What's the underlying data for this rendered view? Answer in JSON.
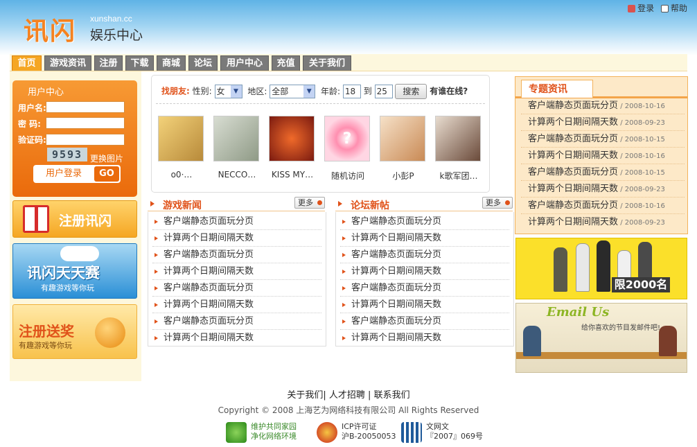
{
  "header": {
    "logo_cn": "讯闪",
    "logo_en": "xunshan.cc",
    "logo_sub": "娱乐中心",
    "login_link": "登录",
    "help_link": "帮助"
  },
  "nav": {
    "tabs": [
      {
        "label": "首页",
        "active": true
      },
      {
        "label": "游戏资讯"
      },
      {
        "label": "注册"
      },
      {
        "label": "下载"
      },
      {
        "label": "商城"
      },
      {
        "label": "论坛"
      },
      {
        "label": "用户中心"
      },
      {
        "label": "充值"
      },
      {
        "label": "关于我们"
      }
    ]
  },
  "login": {
    "title": "用户中心",
    "username_label": "用户名:",
    "password_label": "密  码:",
    "captcha_label": "验证码:",
    "captcha_text": "9593",
    "change_image": "更换图片",
    "login_button": "用户登录",
    "go_button": "GO"
  },
  "banners": {
    "register": "注册讯闪",
    "daily_title": "讯闪天天赛",
    "daily_sub": "有趣游戏等你玩",
    "prize_title": "注册送奖",
    "prize_sub": "有趣游戏等你玩"
  },
  "finder": {
    "title": "找朋友:",
    "gender_label": "性别:",
    "gender_value": "女",
    "region_label": "地区:",
    "region_value": "全部",
    "age_label": "年龄:",
    "age_from": "18",
    "age_to_label": "到",
    "age_to": "25",
    "search_button": "搜索",
    "online_label": "有谁在线?",
    "people": [
      {
        "name": "o0·…"
      },
      {
        "name": "NECCO…"
      },
      {
        "name": "KISS MY…"
      },
      {
        "name": "随机访问"
      },
      {
        "name": "小彭P"
      },
      {
        "name": "k歌军团…"
      }
    ]
  },
  "game_news": {
    "title": "游戏新闻",
    "more": "更多",
    "items": [
      "客户端静态页面玩分页",
      "计算两个日期间隔天数",
      "客户端静态页面玩分页",
      "计算两个日期间隔天数",
      "客户端静态页面玩分页",
      "计算两个日期间隔天数",
      "客户端静态页面玩分页",
      "计算两个日期间隔天数"
    ]
  },
  "forum": {
    "title": "论坛新帖",
    "more": "更多",
    "items": [
      "客户端静态页面玩分页",
      "计算两个日期间隔天数",
      "客户端静态页面玩分页",
      "计算两个日期间隔天数",
      "客户端静态页面玩分页",
      "计算两个日期间隔天数",
      "客户端静态页面玩分页",
      "计算两个日期间隔天数"
    ]
  },
  "special": {
    "title": "专题资讯",
    "items": [
      {
        "text": "客户端静态页面玩分页",
        "date": " / 2008-10-16"
      },
      {
        "text": "计算两个日期间隔天数",
        "date": " / 2008-09-23"
      },
      {
        "text": "客户端静态页面玩分页",
        "date": " / 2008-10-15"
      },
      {
        "text": "计算两个日期间隔天数",
        "date": " / 2008-10-16"
      },
      {
        "text": "客户端静态页面玩分页",
        "date": " / 2008-10-15"
      },
      {
        "text": "计算两个日期间隔天数",
        "date": " / 2008-09-23"
      },
      {
        "text": "客户端静态页面玩分页",
        "date": " / 2008-10-16"
      },
      {
        "text": "计算两个日期间隔天数",
        "date": " / 2008-09-23"
      }
    ]
  },
  "ads": {
    "limit": "限2000名",
    "email_title": "Email Us",
    "email_sub": "给你喜欢的节目发邮件吧!"
  },
  "footer": {
    "links": "关于我们| 人才招聘 | 联系我们",
    "copyright": "Copyright © 2008 上海艺为网络科技有限公司 All Rights Reserved",
    "badge1_a": "维护共同家园",
    "badge1_b": "净化网络环境",
    "badge2_a": "ICP许可证",
    "badge2_b": "沪B-20050053",
    "badge3_a": "文网文",
    "badge3_b": "『2007』069号"
  },
  "colors": {
    "accent": "#f58220",
    "nav_active": "#f5a623",
    "nav_tab": "#7a7a7a",
    "link_red": "#e0521a"
  }
}
